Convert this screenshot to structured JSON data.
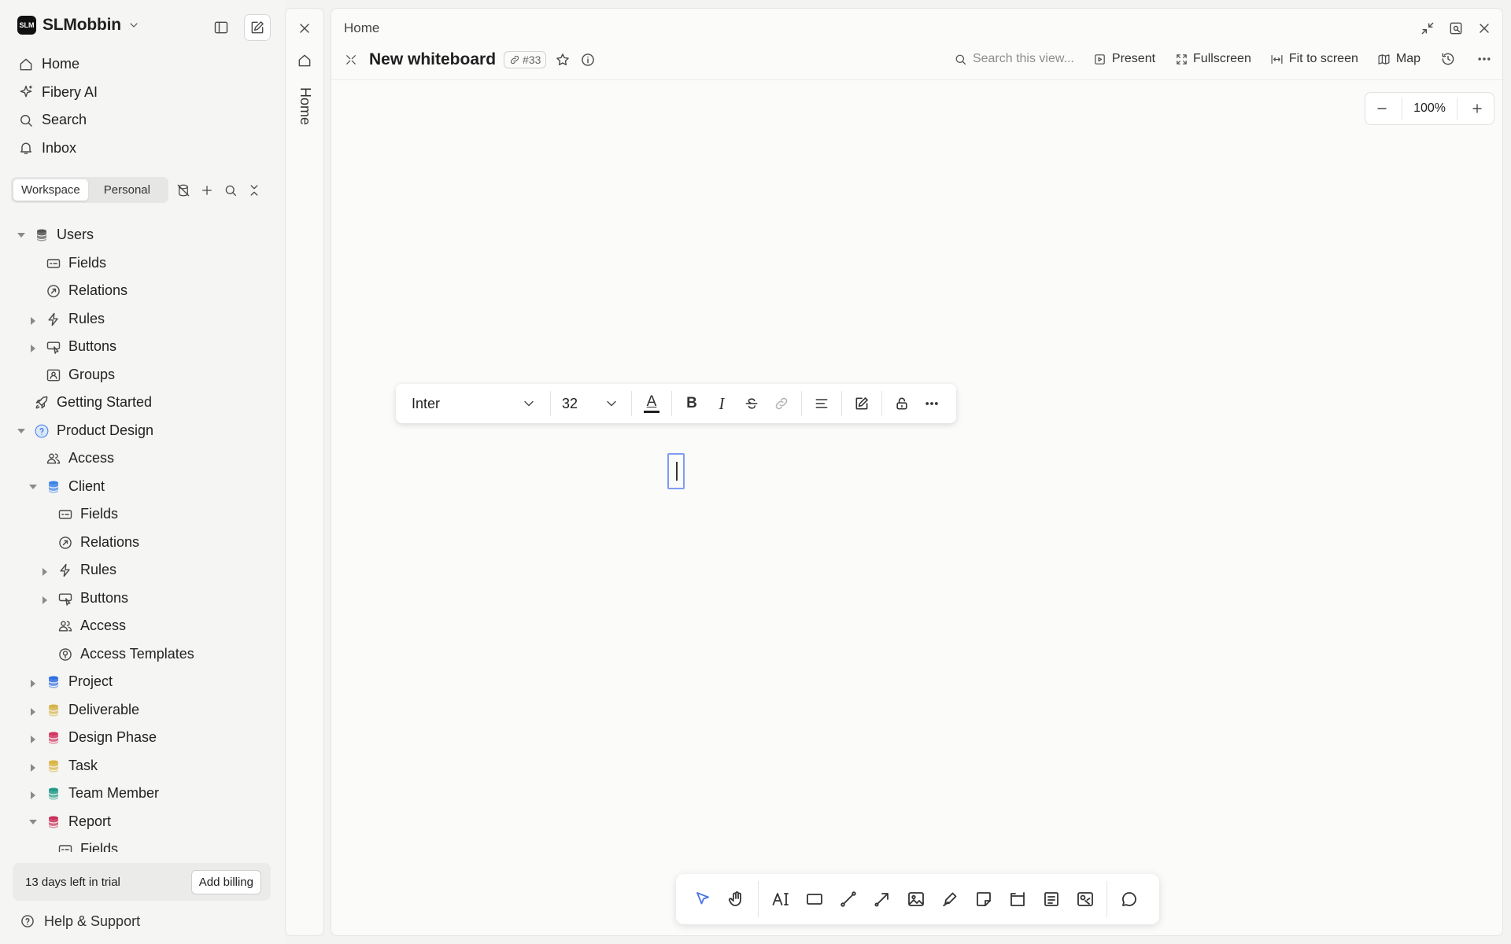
{
  "workspace": {
    "name": "SLMobbin",
    "logo_text": "SLM"
  },
  "nav": [
    {
      "label": "Home",
      "icon": "home-icon"
    },
    {
      "label": "Fibery AI",
      "icon": "sparkle-icon"
    },
    {
      "label": "Search",
      "icon": "search-icon"
    },
    {
      "label": "Inbox",
      "icon": "bell-icon"
    }
  ],
  "space_tabs": {
    "workspace": "Workspace",
    "personal": "Personal"
  },
  "tree": [
    {
      "label": "Users",
      "icon": "database",
      "color": "#555555",
      "indent": 0,
      "caret": "open"
    },
    {
      "label": "Fields",
      "icon": "fields",
      "indent": 1,
      "caret": "none"
    },
    {
      "label": "Relations",
      "icon": "relations",
      "indent": 1,
      "caret": "none"
    },
    {
      "label": "Rules",
      "icon": "bolt",
      "indent": 1,
      "caret": "closed"
    },
    {
      "label": "Buttons",
      "icon": "buttons",
      "indent": 1,
      "caret": "closed"
    },
    {
      "label": "Groups",
      "icon": "groups",
      "indent": 1,
      "caret": "none"
    },
    {
      "label": "Getting Started",
      "icon": "rocket",
      "indent": 0,
      "caret": "none"
    },
    {
      "label": "Product Design",
      "icon": "space",
      "color": "#3f7be8",
      "indent": 0,
      "caret": "open"
    },
    {
      "label": "Access",
      "icon": "people",
      "indent": 1,
      "caret": "none"
    },
    {
      "label": "Client",
      "icon": "database",
      "color": "#3b82e8",
      "indent": 1,
      "caret": "open"
    },
    {
      "label": "Fields",
      "icon": "fields",
      "indent": 2,
      "caret": "none"
    },
    {
      "label": "Relations",
      "icon": "relations",
      "indent": 2,
      "caret": "none"
    },
    {
      "label": "Rules",
      "icon": "bolt",
      "indent": 2,
      "caret": "closed"
    },
    {
      "label": "Buttons",
      "icon": "buttons",
      "indent": 2,
      "caret": "closed"
    },
    {
      "label": "Access",
      "icon": "people",
      "indent": 2,
      "caret": "none"
    },
    {
      "label": "Access Templates",
      "icon": "template",
      "indent": 2,
      "caret": "none"
    },
    {
      "label": "Project",
      "icon": "database",
      "color": "#2f6fe4",
      "indent": 1,
      "caret": "closed"
    },
    {
      "label": "Deliverable",
      "icon": "database",
      "color": "#d4b44a",
      "indent": 1,
      "caret": "closed"
    },
    {
      "label": "Design Phase",
      "icon": "database",
      "color": "#d2345f",
      "indent": 1,
      "caret": "closed"
    },
    {
      "label": "Task",
      "icon": "database",
      "color": "#d9b545",
      "indent": 1,
      "caret": "closed"
    },
    {
      "label": "Team Member",
      "icon": "database",
      "color": "#1f9a8a",
      "indent": 1,
      "caret": "closed"
    },
    {
      "label": "Report",
      "icon": "database",
      "color": "#c9315a",
      "indent": 1,
      "caret": "open"
    },
    {
      "label": "Fields",
      "icon": "fields",
      "indent": 2,
      "caret": "none"
    }
  ],
  "trial": {
    "text": "13 days left in trial",
    "button": "Add billing"
  },
  "help": "Help & Support",
  "strip": {
    "label": "Home"
  },
  "main": {
    "breadcrumb": "Home",
    "title": "New whiteboard",
    "id_badge": "#33",
    "search_placeholder": "Search this view...",
    "toolbar": {
      "present": "Present",
      "fullscreen": "Fullscreen",
      "fit": "Fit to screen",
      "map": "Map"
    },
    "zoom": "100%"
  },
  "format_bar": {
    "font": "Inter",
    "size": "32",
    "text_color": "#1f1f1f"
  },
  "draw_tools": [
    "select-tool",
    "hand-tool",
    "text-tool",
    "rectangle-tool",
    "line-tool",
    "arrow-tool",
    "image-tool",
    "pen-tool",
    "sticky-note-tool",
    "frame-tool",
    "card-tool",
    "embed-tool",
    "comment-tool"
  ],
  "colors": {
    "accent": "#4a72e8",
    "selection": "#7f9cf5"
  }
}
